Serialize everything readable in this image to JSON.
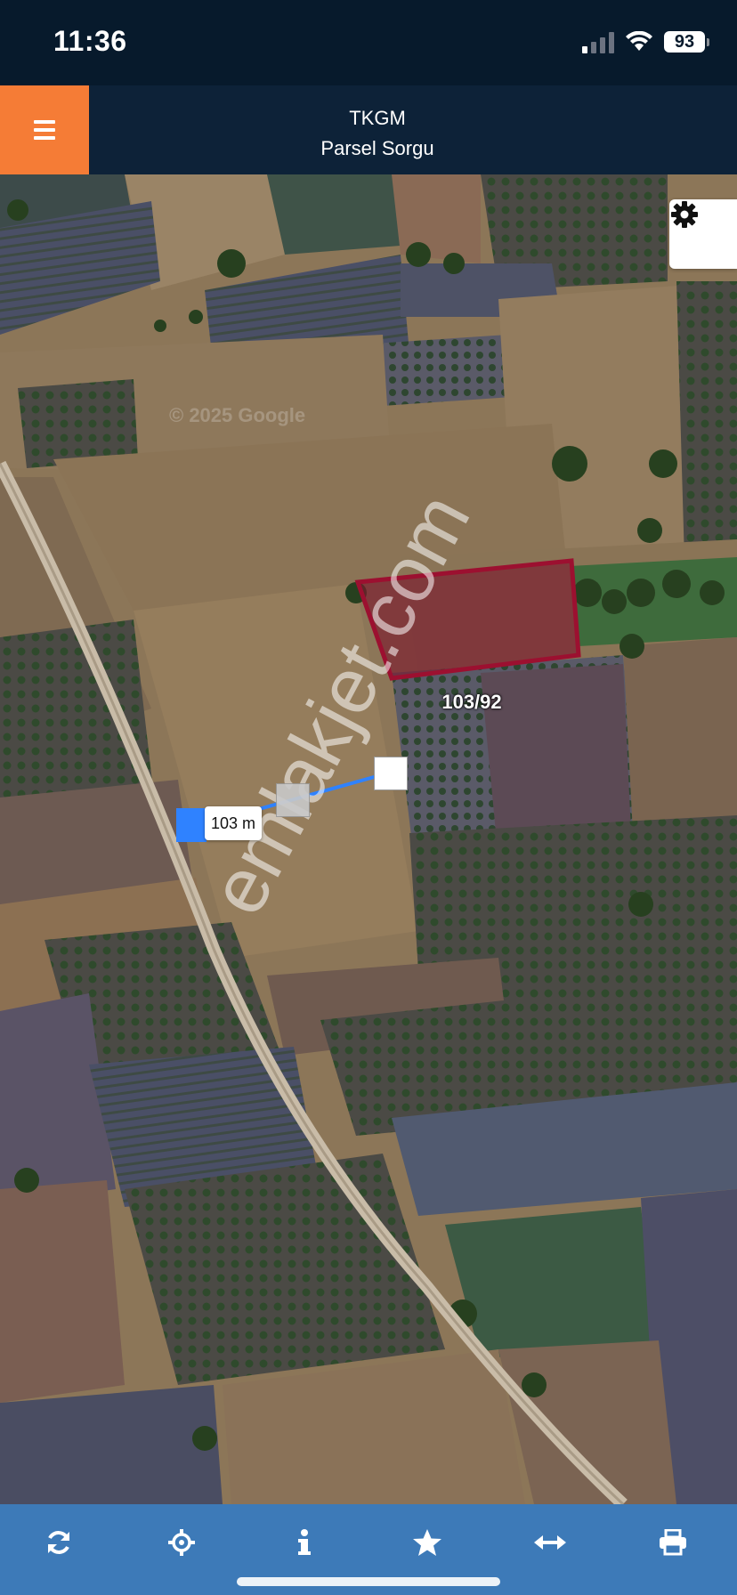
{
  "status_bar": {
    "time": "11:36",
    "battery": "93"
  },
  "header": {
    "title_line1": "TKGM",
    "title_line2": "Parsel Sorgu"
  },
  "map": {
    "parcel_label": "103/92",
    "distance_label": "103 m",
    "watermark": "emlakjet.com",
    "attribution": "© 2025 Google"
  },
  "toolbar": {
    "icons": [
      "refresh-icon",
      "locate-icon",
      "info-icon",
      "star-icon",
      "measure-icon",
      "print-icon"
    ]
  },
  "colors": {
    "status_bg": "#071a2c",
    "header_bg": "#0d2238",
    "menu_accent": "#f57c36",
    "toolbar_bg": "#3d7ab8",
    "parcel_outline": "#9c1030",
    "measure_line": "#2f82ff"
  }
}
